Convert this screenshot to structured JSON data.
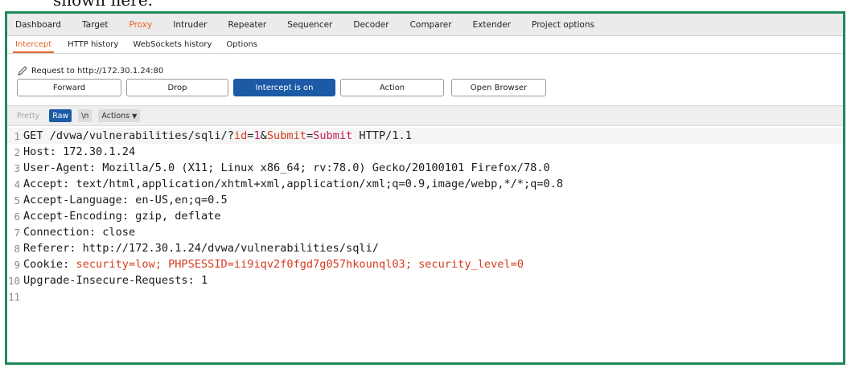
{
  "page_top_text": "shown here.",
  "main_tabs": [
    "Dashboard",
    "Target",
    "Proxy",
    "Intruder",
    "Repeater",
    "Sequencer",
    "Decoder",
    "Comparer",
    "Extender",
    "Project options"
  ],
  "sub_tabs": [
    "Intercept",
    "HTTP history",
    "WebSockets history",
    "Options"
  ],
  "request_label": "Request to http://172.30.1.24:80",
  "buttons": {
    "forward": "Forward",
    "drop": "Drop",
    "intercept": "Intercept is on",
    "action": "Action",
    "open_browser": "Open Browser"
  },
  "editor_toolbar": {
    "pretty": "Pretty",
    "raw": "Raw",
    "newline": "\\n",
    "actions": "Actions"
  },
  "lines": {
    "l1": {
      "n": "1",
      "method": "GET /dvwa/vulnerabilities/sqli/?",
      "p1": "id",
      "eq1": "=",
      "v1": "1",
      "amp": "&",
      "p2": "Submit",
      "eq2": "=",
      "v2": "Submit",
      "rest": " HTTP/1.1"
    },
    "l2": {
      "n": "2",
      "text": "Host: 172.30.1.24"
    },
    "l3": {
      "n": "3",
      "text": "User-Agent: Mozilla/5.0 (X11; Linux x86_64; rv:78.0) Gecko/20100101 Firefox/78.0"
    },
    "l4": {
      "n": "4",
      "text": "Accept: text/html,application/xhtml+xml,application/xml;q=0.9,image/webp,*/*;q=0.8"
    },
    "l5": {
      "n": "5",
      "text": "Accept-Language: en-US,en;q=0.5"
    },
    "l6": {
      "n": "6",
      "text": "Accept-Encoding: gzip, deflate"
    },
    "l7": {
      "n": "7",
      "text": "Connection: close"
    },
    "l8": {
      "n": "8",
      "text": "Referer: http://172.30.1.24/dvwa/vulnerabilities/sqli/"
    },
    "l9": {
      "n": "9",
      "label": "Cookie: ",
      "c1": "security=low; ",
      "c2": "PHPSESSID=ii9iqv2f0fgd7g057hkounql03; ",
      "c3": "security_level=0"
    },
    "l10": {
      "n": "10",
      "text": "Upgrade-Insecure-Requests: 1"
    },
    "l11": {
      "n": "11",
      "text": ""
    }
  },
  "colors": {
    "frame": "#1e8a5c",
    "accent_orange": "#e8632b",
    "button_blue": "#1c5aa6",
    "param_red": "#d63b1d",
    "value_pink": "#c2185b"
  }
}
